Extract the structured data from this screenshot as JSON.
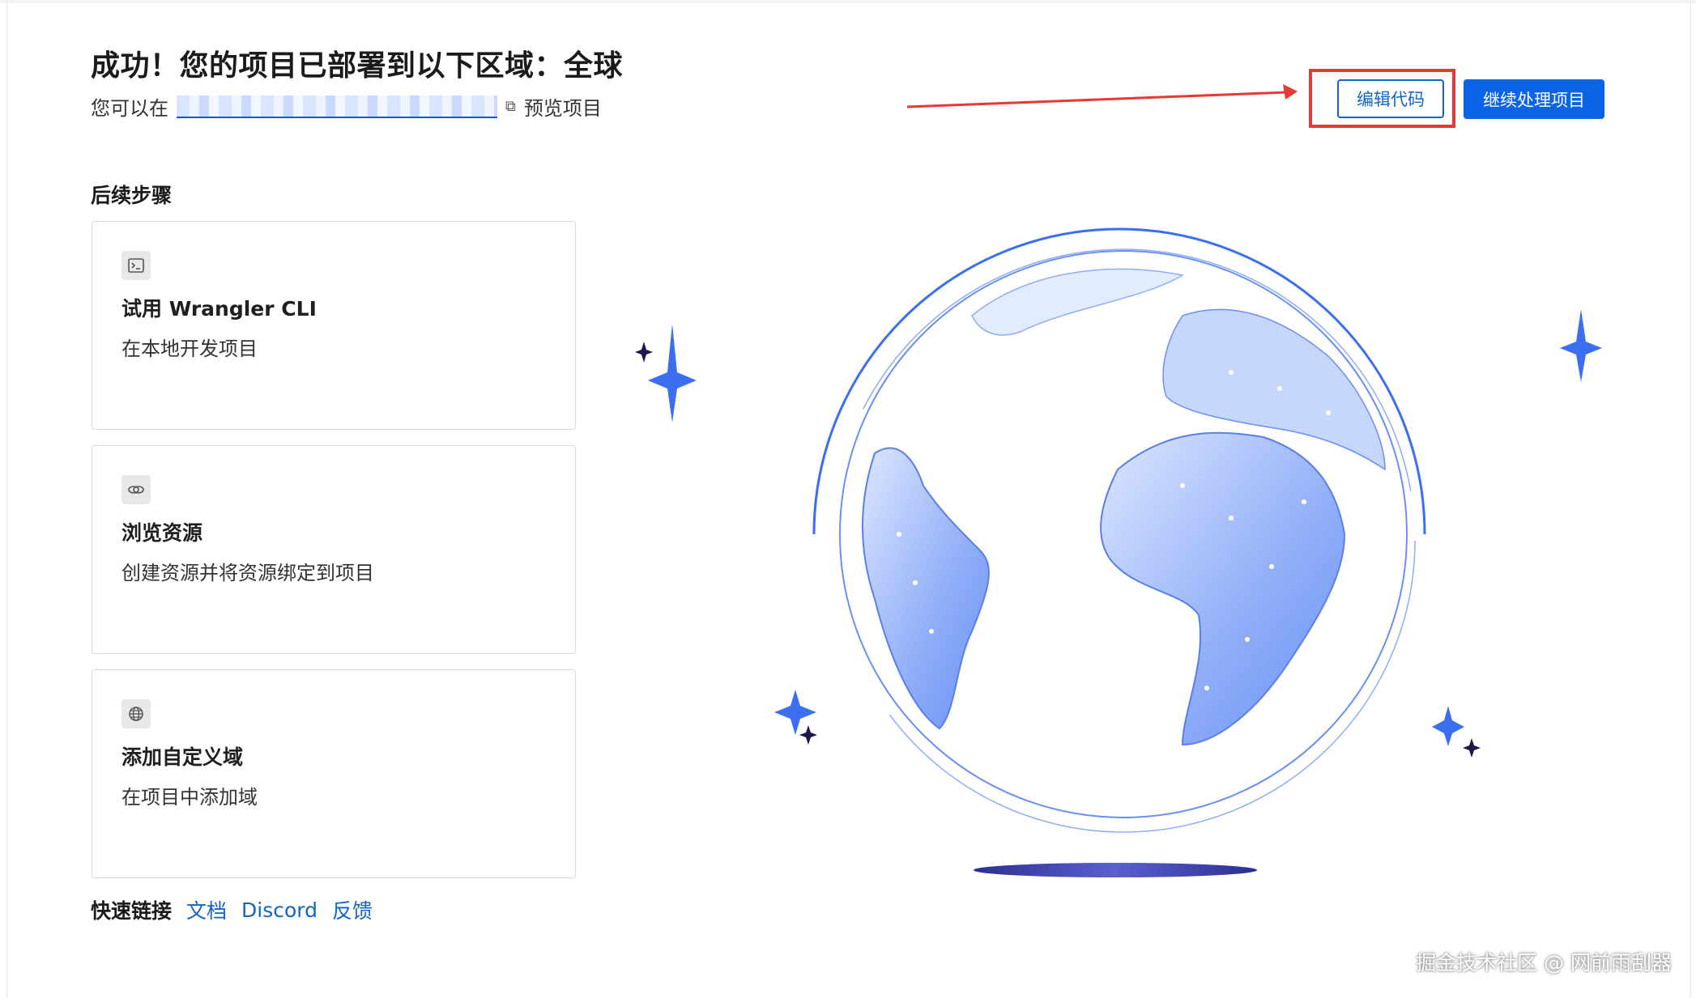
{
  "header": {
    "title": "成功！您的项目已部署到以下区域：全球",
    "subtitle_prefix": "您可以在",
    "subtitle_suffix": "预览项目"
  },
  "actions": {
    "edit_code_label": "编辑代码",
    "continue_label": "继续处理项目"
  },
  "next_steps": {
    "heading": "后续步骤",
    "cards": [
      {
        "icon": "terminal-icon",
        "title": "试用 Wrangler CLI",
        "description": "在本地开发项目"
      },
      {
        "icon": "link-icon",
        "title": "浏览资源",
        "description": "创建资源并将资源绑定到项目"
      },
      {
        "icon": "globe-icon",
        "title": "添加自定义域",
        "description": "在项目中添加域"
      }
    ]
  },
  "quick_links": {
    "label": "快速链接",
    "links": [
      "文档",
      "Discord",
      "反馈"
    ]
  },
  "watermark": "掘金技术社区 @ 网前雨刮器",
  "colors": {
    "primary": "#0b63e5",
    "link": "#1565c0",
    "highlight": "#e53935",
    "globe": "#6a8ff5"
  }
}
